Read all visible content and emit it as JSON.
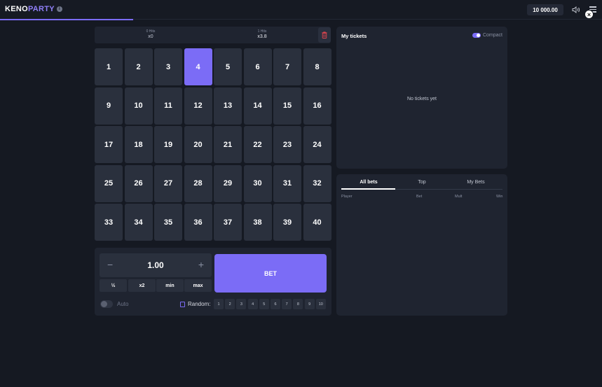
{
  "header": {
    "logo_part1": "KENO",
    "logo_part2": "PARTY",
    "balance": "10 000.00",
    "icons": [
      "info-icon",
      "sound-icon",
      "menu-icon",
      "close-icon"
    ]
  },
  "hits": [
    {
      "label": "0 Hits",
      "value": "x0"
    },
    {
      "label": "1 Hits",
      "value": "x3.8"
    }
  ],
  "grid": {
    "numbers": [
      "1",
      "2",
      "3",
      "4",
      "5",
      "6",
      "7",
      "8",
      "9",
      "10",
      "11",
      "12",
      "13",
      "14",
      "15",
      "16",
      "17",
      "18",
      "19",
      "20",
      "21",
      "22",
      "23",
      "24",
      "25",
      "26",
      "27",
      "28",
      "29",
      "30",
      "31",
      "32",
      "33",
      "34",
      "35",
      "36",
      "37",
      "38",
      "39",
      "40"
    ],
    "selected": [
      "4"
    ]
  },
  "bet": {
    "amount": "1.00",
    "minus": "−",
    "plus": "+",
    "quick": [
      "½",
      "x2",
      "min",
      "max"
    ],
    "bet_label": "BET",
    "auto_label": "Auto",
    "random_label": "Random:",
    "random_options": [
      "1",
      "2",
      "3",
      "4",
      "5",
      "6",
      "7",
      "8",
      "9",
      "10"
    ]
  },
  "tickets": {
    "title": "My tickets",
    "compact_label": "Compact",
    "empty": "No tickets yet"
  },
  "bets_panel": {
    "tabs": [
      "All bets",
      "Top",
      "My Bets"
    ],
    "columns": [
      "Player",
      "Bet",
      "Mult",
      "Win"
    ]
  },
  "colors": {
    "accent": "#7b6cf6",
    "background": "#151922",
    "panel": "#1f2430",
    "cell": "#2a303d"
  }
}
